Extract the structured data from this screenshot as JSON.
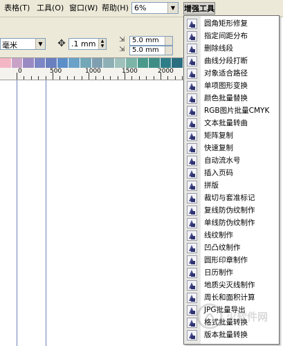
{
  "menubar": {
    "items": [
      {
        "label": "表格(T)"
      },
      {
        "label": "工具(O)"
      },
      {
        "label": "窗口(W)"
      },
      {
        "label": "帮助(H)"
      }
    ],
    "zoom_value": "6%",
    "enhance_menu_label": "增强工具"
  },
  "toolbar": {
    "unit_value": "毫米",
    "nudge_value": ".1 mm",
    "dup_x": "5.0 mm",
    "dup_y": "5.0 mm"
  },
  "palette": [
    "#f4b6c4",
    "#c9a2c8",
    "#9a8ac4",
    "#7c86c4",
    "#6a7fbe",
    "#5c8ec8",
    "#6aa2c8",
    "#74a8b8",
    "#7f9fb0",
    "#8eb0b4",
    "#a0c0bc",
    "#7cb4a8",
    "#4a9a8c",
    "#3e8e86",
    "#2e7e88",
    "#2a6e80"
  ],
  "ruler": {
    "labels": [
      "0",
      "500",
      "1000",
      "1500",
      "2000"
    ]
  },
  "enhance_menu": {
    "items": [
      {
        "label": "圆角矩形修复"
      },
      {
        "label": "指定间距分布"
      },
      {
        "label": "删除线段"
      },
      {
        "label": "曲线分段打断"
      },
      {
        "label": "对象适合路径"
      },
      {
        "label": "单项图形变换"
      },
      {
        "label": "颜色批量替换"
      },
      {
        "label": "RGB图片批量CMYK"
      },
      {
        "label": "文本批量转曲"
      },
      {
        "label": "矩阵复制"
      },
      {
        "label": "快速复制"
      },
      {
        "label": "自动流水号"
      },
      {
        "label": "插入页码"
      },
      {
        "label": "拼版"
      },
      {
        "label": "裁切与套准标记"
      },
      {
        "label": "复线防伪纹制作"
      },
      {
        "label": "单线防伪纹制作"
      },
      {
        "label": "线纹制作"
      },
      {
        "label": "凹凸纹制作"
      },
      {
        "label": "圆形印章制作"
      },
      {
        "label": "日历制作"
      },
      {
        "label": "地质尖灭线制作"
      },
      {
        "label": "周长和面积计算"
      },
      {
        "label": "JPG批量导出"
      },
      {
        "label": "格式批量转换"
      },
      {
        "label": "版本批量转换"
      }
    ]
  },
  "watermark_text": "火软件网"
}
